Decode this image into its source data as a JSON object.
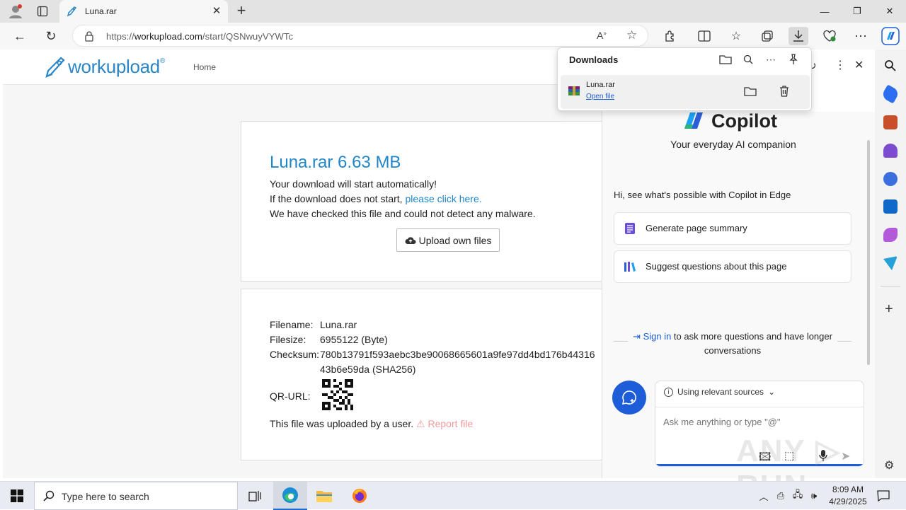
{
  "browser": {
    "tab_title": "Luna.rar",
    "url_prefix": "https://",
    "url_domain": "workupload.com",
    "url_path": "/start/QSNwuyVYWTc"
  },
  "site": {
    "logo": "workupload",
    "logo_reg": "®",
    "nav_home": "Home",
    "file_title": "Luna.rar 6.63 MB",
    "auto_start": "Your download will start automatically!",
    "not_start_prefix": "If the download does not start, ",
    "click_here": "please click here.",
    "malware_note": "We have checked this file and could not detect any malware.",
    "upload_button": "Upload own files",
    "details": {
      "filename_label": "Filename:",
      "filename": "Luna.rar",
      "filesize_label": "Filesize:",
      "filesize": "6955122 (Byte)",
      "checksum_label": "Checksum:",
      "checksum_line1": "780b13791f593aebc3be90068665601a9fe97dd4bd176b44316",
      "checksum_line2": "43b6e59da (SHA256)",
      "qr_label": "QR-URL:"
    },
    "uploaded_by": "This file was uploaded by a user.",
    "report": "Report file"
  },
  "downloads": {
    "title": "Downloads",
    "file_name": "Luna.rar",
    "open_file": "Open file"
  },
  "copilot": {
    "title": "Copilot",
    "subtitle": "Your everyday AI companion",
    "hint": "Hi, see what's possible with Copilot in Edge",
    "suggestion_1": "Generate page summary",
    "suggestion_2": "Suggest questions about this page",
    "sign_in": "Sign in",
    "sign_in_rest": " to ask more questions and have longer conversations",
    "sources": "Using relevant sources",
    "input_placeholder": "Ask me anything or type \"@\""
  },
  "taskbar": {
    "search_placeholder": "Type here to search",
    "time": "8:09 AM",
    "date": "4/29/2025"
  },
  "colors": {
    "brand_blue": "#1f86c9",
    "copilot_blue": "#1d5ed8",
    "report_red": "#f09a9a"
  }
}
